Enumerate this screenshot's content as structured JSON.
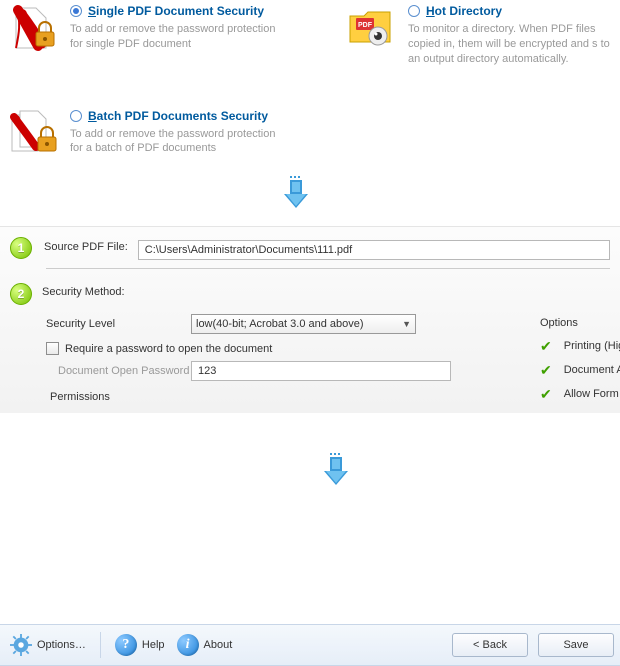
{
  "modes": {
    "single": {
      "label": "ingle PDF Document Security",
      "accel": "S",
      "desc": "To add or remove the password protection for single PDF document",
      "checked": true
    },
    "hot": {
      "label": "ot Directory",
      "accel": "H",
      "desc": "To monitor a directory. When PDF files copied in, them will be encrypted and s to an output directory automatically.",
      "checked": false
    },
    "batch": {
      "label": "atch PDF Documents Security",
      "accel": "B",
      "desc": "To add or remove the password protection for a batch of PDF documents",
      "checked": false
    }
  },
  "step1": {
    "num": "1",
    "label": "Source PDF File:",
    "value": "C:\\Users\\Administrator\\Documents\\111.pdf"
  },
  "step2": {
    "num": "2",
    "title": "Security Method:",
    "level_label": "Security Level",
    "level_value": "low(40-bit; Acrobat 3.0 and above)",
    "require_pw": "Require a password to open the document",
    "doc_pw_label": "Document Open Password",
    "doc_pw_value": "123",
    "perm_header": "Permissions"
  },
  "options": {
    "title": "Options",
    "items": [
      "Printing (Hig",
      "Document A",
      "Allow Form"
    ]
  },
  "bottom": {
    "options": "Options…",
    "help": "Help",
    "about": "About",
    "back": "< Back",
    "save": "Save"
  }
}
